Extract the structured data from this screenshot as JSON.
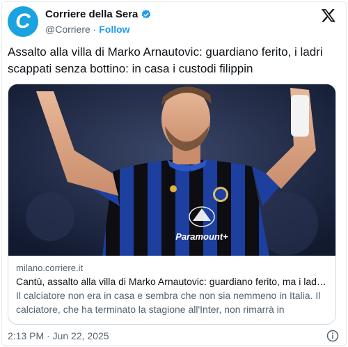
{
  "author": {
    "name": "Corriere della Sera",
    "handle": "@Corriere",
    "separator": "·",
    "follow_label": "Follow",
    "avatar_letter": "C",
    "avatar_color": "#1aa3e0",
    "verified_color": "#1d9bf0"
  },
  "tweet": {
    "text": "Assalto alla villa di Marko Arnautovic: guardiano ferito, i ladri scappati senza bottino: in casa i custodi filippin"
  },
  "card": {
    "domain": "milano.corriere.it",
    "title": "Cantù, assalto alla villa di Marko Arnautovic: guardiano ferito, ma i ladri ...",
    "description": "Il calciatore non era in casa e sembra che non sia nemmeno in Italia. Il calciatore, che ha terminato la stagione all'Inter, non rimarrà in nerazzurr...",
    "image": {
      "jersey_sponsor": "Paramount+",
      "jersey_colors": [
        "#1c3fa0",
        "#0d0d12"
      ]
    }
  },
  "timestamp": "2:13 PM · Jun 22, 2025",
  "icons": {
    "close": "x-logo-icon",
    "info": "info-icon",
    "verified": "verified-badge-icon"
  }
}
